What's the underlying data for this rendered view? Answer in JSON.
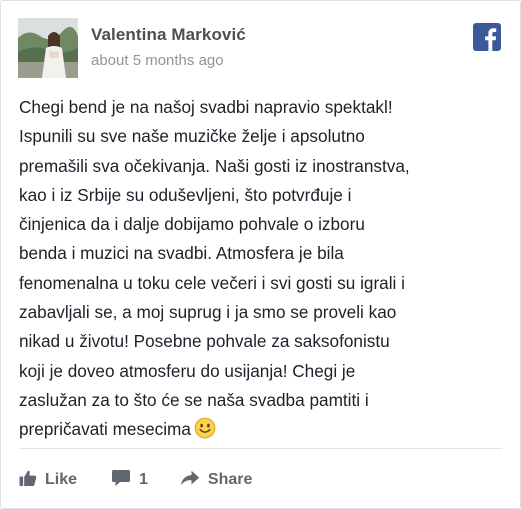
{
  "post": {
    "author": "Valentina Marković",
    "timestamp": "about 5 months ago",
    "source_icon": "facebook-icon",
    "text_lines": [
      "Chegi bend je na našoj svadbi napravio spektakl!",
      "Ispunili su sve naše muzičke želje i apsolutno",
      "premašili sva očekivanja. Naši gosti iz inostranstva,",
      "kao i iz Srbije su oduševljeni, što potvrđuje i",
      "činjenica da i dalje dobijamo pohvale o izboru",
      "benda i muzici na svadbi. Atmosfera je bila",
      "fenomenalna u toku cele večeri i svi gosti su igrali i",
      "zabavljali se, a moj suprug i ja smo se proveli kao",
      "nikad u životu! Posebne pohvale za saksofonistu",
      "koji je doveo atmosferu do usijanja! Chegi je",
      "zaslužan za to što će se naša svadba pamtiti i",
      "prepričavati mesecima"
    ],
    "emoji": "smiley-emoji"
  },
  "actions": {
    "like_label": "Like",
    "comment_count": "1",
    "share_label": "Share"
  },
  "colors": {
    "facebook_blue": "#3b5998",
    "name_color": "#4b4f56",
    "meta_color": "#90949c",
    "action_color": "#606770"
  }
}
